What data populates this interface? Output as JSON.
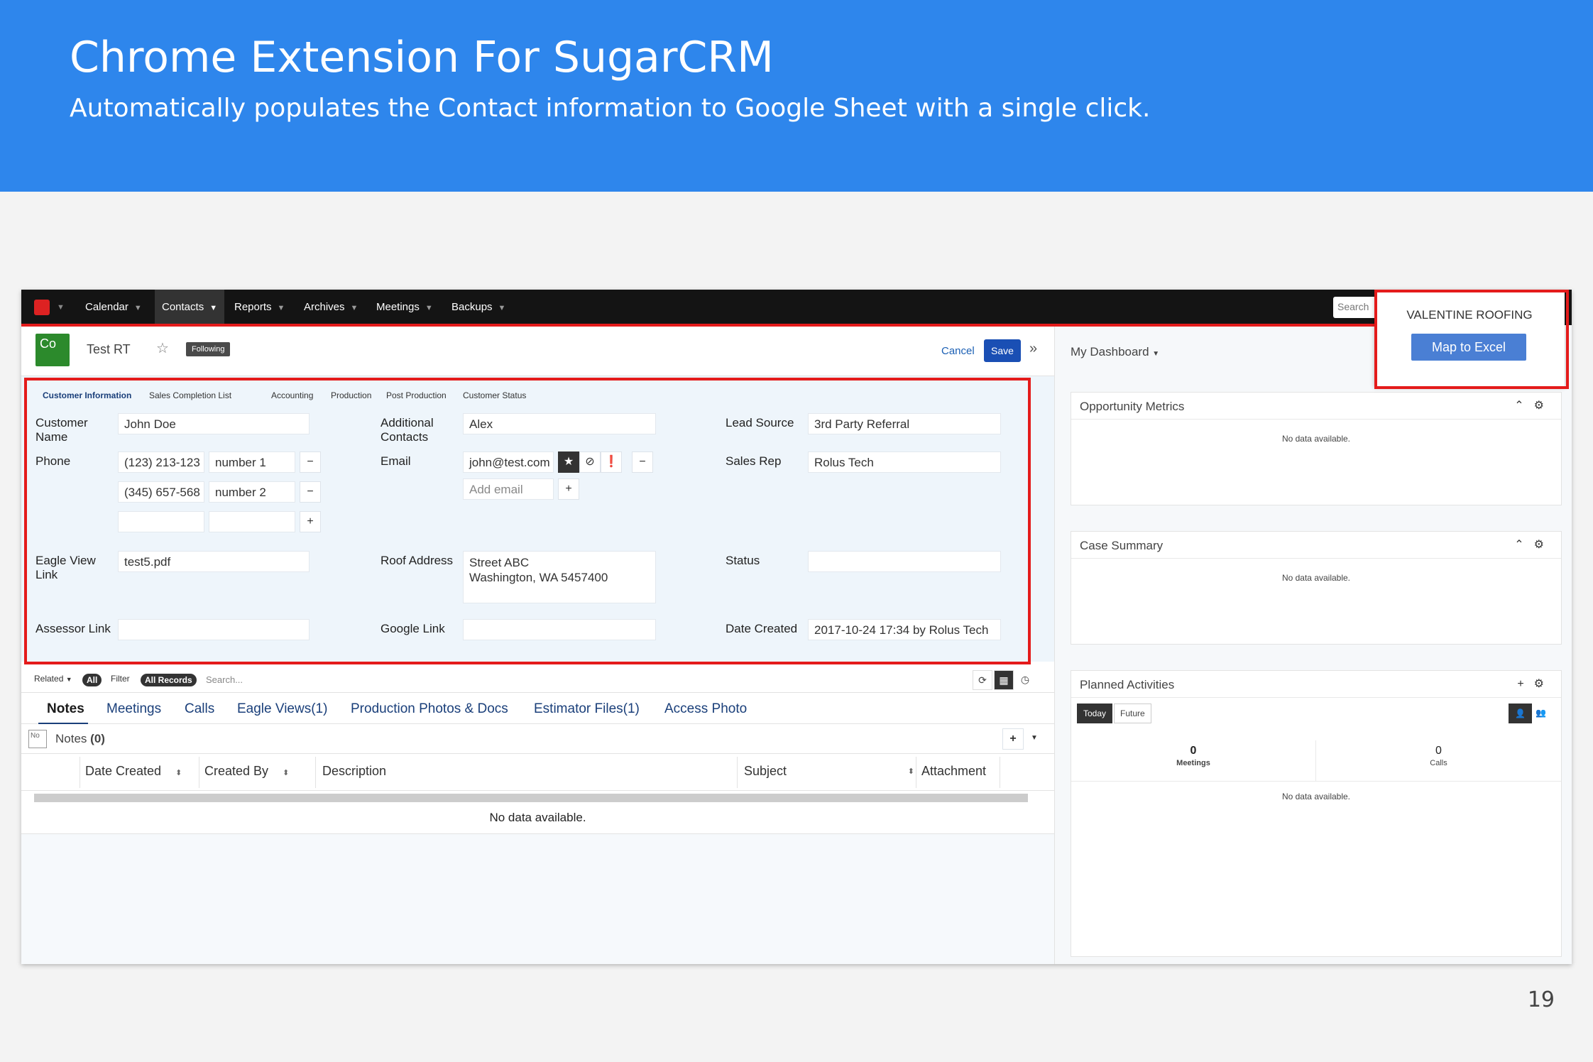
{
  "slide": {
    "title": "Chrome Extension For SugarCRM",
    "subtitle": "Automatically populates the Contact information to Google Sheet with a single click.",
    "page_number": "19"
  },
  "nav": {
    "items": [
      "Calendar",
      "Contacts",
      "Reports",
      "Archives",
      "Meetings",
      "Backups"
    ],
    "active": "Contacts",
    "search_placeholder": "Search"
  },
  "record": {
    "module_badge": "Co",
    "name": "Test RT",
    "following": "Following",
    "cancel": "Cancel",
    "save": "Save"
  },
  "info_tabs": [
    "Customer Information",
    "Sales Completion List",
    "Accounting",
    "Production",
    "Post Production",
    "Customer Status"
  ],
  "fields": {
    "customer_name_label": "Customer Name",
    "customer_name": "John Doe",
    "phone_label": "Phone",
    "phone1": "(123) 213-123",
    "phone1_type": "number 1",
    "phone2": "(345) 657-568",
    "phone2_type": "number 2",
    "eagle_view_label": "Eagle View Link",
    "eagle_view": "test5.pdf",
    "assessor_label": "Assessor Link",
    "additional_contacts_label": "Additional Contacts",
    "additional_contacts": "Alex",
    "email_label": "Email",
    "email": "john@test.com",
    "add_email": "Add email",
    "roof_address_label": "Roof Address",
    "roof_address_line1": "Street ABC",
    "roof_address_line2": "Washington, WA  5457400",
    "google_link_label": "Google Link",
    "lead_source_label": "Lead Source",
    "lead_source": "3rd Party Referral",
    "sales_rep_label": "Sales Rep",
    "sales_rep": "Rolus Tech",
    "status_label": "Status",
    "date_created_label": "Date Created",
    "date_created": "2017-10-24 17:34  by  Rolus Tech"
  },
  "subpanel": {
    "related": "Related",
    "all": "All",
    "filter": "Filter",
    "all_records": "All Records",
    "search_placeholder": "Search...",
    "tabs": [
      "Notes",
      "Meetings",
      "Calls",
      "Eagle Views(1)",
      "Production Photos & Docs",
      "Estimator Files(1)",
      "Access Photo"
    ],
    "no_badge": "No",
    "notes_title": "Notes",
    "notes_count": "(0)",
    "columns": [
      "Date Created",
      "Created By",
      "Description",
      "Subject",
      "Attachment"
    ],
    "no_data": "No data available."
  },
  "dashboard": {
    "title": "My Dashboard",
    "opportunity": "Opportunity Metrics",
    "case_summary": "Case Summary",
    "planned": "Planned Activities",
    "today": "Today",
    "future": "Future",
    "meetings_count": "0",
    "meetings_label": "Meetings",
    "calls_count": "0",
    "calls_label": "Calls",
    "no_data": "No data available."
  },
  "extension": {
    "title": "VALENTINE ROOFING",
    "button": "Map to Excel"
  },
  "colors": {
    "banner": "#2e86ec",
    "highlight": "#e41b1b",
    "save": "#1a4fb4",
    "map_button": "#4a7fd4"
  }
}
